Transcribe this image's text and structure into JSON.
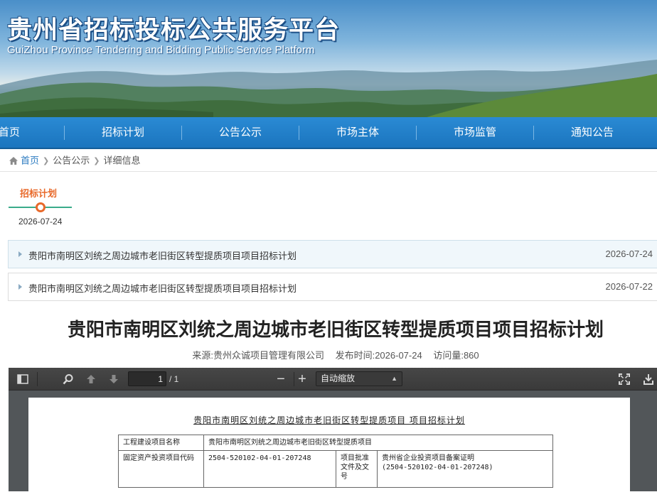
{
  "header": {
    "title": "贵州省招标投标公共服务平台",
    "subtitle": "GuiZhou Province Tendering and Bidding Public Service Platform"
  },
  "nav": {
    "items": [
      "首页",
      "招标计划",
      "公告公示",
      "市场主体",
      "市场监管",
      "通知公告"
    ]
  },
  "breadcrumb": {
    "home": "首页",
    "section": "公告公示",
    "current": "详细信息"
  },
  "timeline": {
    "tab": "招标计划",
    "date": "2026-07-24"
  },
  "list": [
    {
      "title": "贵阳市南明区刘统之周边城市老旧街区转型提质项目项目招标计划",
      "date": "2026-07-24"
    },
    {
      "title": "贵阳市南明区刘统之周边城市老旧街区转型提质项目项目招标计划",
      "date": "2026-07-22"
    }
  ],
  "article": {
    "title": "贵阳市南明区刘统之周边城市老旧街区转型提质项目项目招标计划",
    "source": "来源:贵州众诚项目管理有限公司",
    "publish_time": "发布时间:2026-07-24",
    "visits": "访问量:860"
  },
  "pdf": {
    "page_current": "1",
    "page_count": "/ 1",
    "zoom": "自动缩放",
    "doc_title": "贵阳市南明区刘统之周边城市老旧街区转型提质项目 项目招标计划",
    "table": {
      "r1_label": "工程建设项目名称",
      "r1_value": "贵阳市南明区刘统之周边城市老旧街区转型提质项目",
      "r2_label": "固定资产投资项目代码",
      "r2_value": "2504-520102-04-01-207248",
      "r2_label2": "项目批准文件及文号",
      "r2_value2_line1": "贵州省企业投资项目备案证明",
      "r2_value2_line2": "(2504-520102-04-01-207248)"
    }
  },
  "colors": {
    "nav_bg": "#1b75be",
    "accent_orange": "#e8692a",
    "timeline_green": "#3aab8a",
    "link_blue": "#2a7ac0"
  }
}
